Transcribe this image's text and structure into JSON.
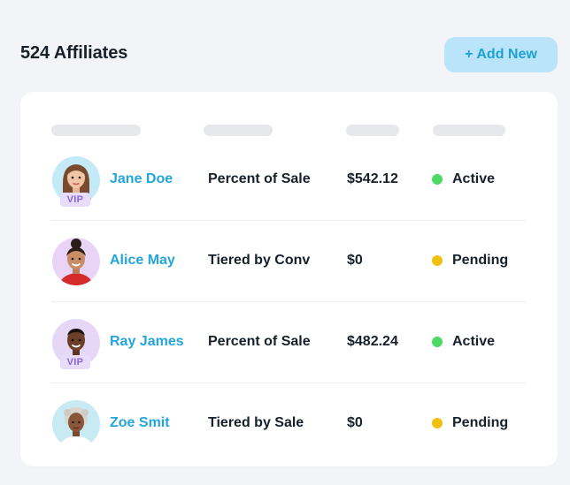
{
  "header": {
    "title": "524 Affiliates",
    "add_button_label": "+ Add New"
  },
  "colors": {
    "accent": "#23a6dd",
    "button_bg": "#b9e4f9",
    "active_dot": "#4cd964",
    "pending_dot": "#f2c10f",
    "vip_bg": "#e7ddfa",
    "vip_text": "#8c64d8"
  },
  "table": {
    "header_placeholders": [
      "name-column",
      "plan-column",
      "amount-column",
      "status-column"
    ],
    "rows": [
      {
        "name": "Jane Doe",
        "badge": "VIP",
        "plan": "Percent of Sale",
        "amount": "$542.12",
        "status": "Active",
        "status_color": "#4cd964",
        "avatar": "avatar-jane"
      },
      {
        "name": "Alice May",
        "badge": "",
        "plan": "Tiered by Conv",
        "amount": "$0",
        "status": "Pending",
        "status_color": "#f2c10f",
        "avatar": "avatar-alice"
      },
      {
        "name": "Ray James",
        "badge": "VIP",
        "plan": "Percent of Sale",
        "amount": "$482.24",
        "status": "Active",
        "status_color": "#4cd964",
        "avatar": "avatar-ray"
      },
      {
        "name": "Zoe Smit",
        "badge": "",
        "plan": "Tiered by Sale",
        "amount": "$0",
        "status": "Pending",
        "status_color": "#f2c10f",
        "avatar": "avatar-zoe"
      }
    ]
  }
}
